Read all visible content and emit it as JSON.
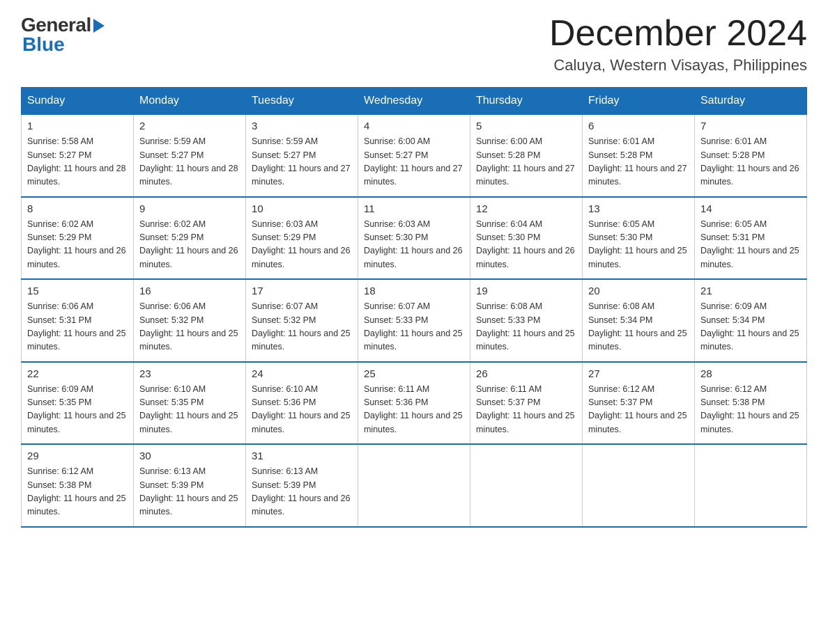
{
  "logo": {
    "general": "General",
    "blue": "Blue"
  },
  "header": {
    "month_title": "December 2024",
    "location": "Caluya, Western Visayas, Philippines"
  },
  "days_of_week": [
    "Sunday",
    "Monday",
    "Tuesday",
    "Wednesday",
    "Thursday",
    "Friday",
    "Saturday"
  ],
  "weeks": [
    [
      {
        "day": "1",
        "sunrise": "5:58 AM",
        "sunset": "5:27 PM",
        "daylight": "11 hours and 28 minutes."
      },
      {
        "day": "2",
        "sunrise": "5:59 AM",
        "sunset": "5:27 PM",
        "daylight": "11 hours and 28 minutes."
      },
      {
        "day": "3",
        "sunrise": "5:59 AM",
        "sunset": "5:27 PM",
        "daylight": "11 hours and 27 minutes."
      },
      {
        "day": "4",
        "sunrise": "6:00 AM",
        "sunset": "5:27 PM",
        "daylight": "11 hours and 27 minutes."
      },
      {
        "day": "5",
        "sunrise": "6:00 AM",
        "sunset": "5:28 PM",
        "daylight": "11 hours and 27 minutes."
      },
      {
        "day": "6",
        "sunrise": "6:01 AM",
        "sunset": "5:28 PM",
        "daylight": "11 hours and 27 minutes."
      },
      {
        "day": "7",
        "sunrise": "6:01 AM",
        "sunset": "5:28 PM",
        "daylight": "11 hours and 26 minutes."
      }
    ],
    [
      {
        "day": "8",
        "sunrise": "6:02 AM",
        "sunset": "5:29 PM",
        "daylight": "11 hours and 26 minutes."
      },
      {
        "day": "9",
        "sunrise": "6:02 AM",
        "sunset": "5:29 PM",
        "daylight": "11 hours and 26 minutes."
      },
      {
        "day": "10",
        "sunrise": "6:03 AM",
        "sunset": "5:29 PM",
        "daylight": "11 hours and 26 minutes."
      },
      {
        "day": "11",
        "sunrise": "6:03 AM",
        "sunset": "5:30 PM",
        "daylight": "11 hours and 26 minutes."
      },
      {
        "day": "12",
        "sunrise": "6:04 AM",
        "sunset": "5:30 PM",
        "daylight": "11 hours and 26 minutes."
      },
      {
        "day": "13",
        "sunrise": "6:05 AM",
        "sunset": "5:30 PM",
        "daylight": "11 hours and 25 minutes."
      },
      {
        "day": "14",
        "sunrise": "6:05 AM",
        "sunset": "5:31 PM",
        "daylight": "11 hours and 25 minutes."
      }
    ],
    [
      {
        "day": "15",
        "sunrise": "6:06 AM",
        "sunset": "5:31 PM",
        "daylight": "11 hours and 25 minutes."
      },
      {
        "day": "16",
        "sunrise": "6:06 AM",
        "sunset": "5:32 PM",
        "daylight": "11 hours and 25 minutes."
      },
      {
        "day": "17",
        "sunrise": "6:07 AM",
        "sunset": "5:32 PM",
        "daylight": "11 hours and 25 minutes."
      },
      {
        "day": "18",
        "sunrise": "6:07 AM",
        "sunset": "5:33 PM",
        "daylight": "11 hours and 25 minutes."
      },
      {
        "day": "19",
        "sunrise": "6:08 AM",
        "sunset": "5:33 PM",
        "daylight": "11 hours and 25 minutes."
      },
      {
        "day": "20",
        "sunrise": "6:08 AM",
        "sunset": "5:34 PM",
        "daylight": "11 hours and 25 minutes."
      },
      {
        "day": "21",
        "sunrise": "6:09 AM",
        "sunset": "5:34 PM",
        "daylight": "11 hours and 25 minutes."
      }
    ],
    [
      {
        "day": "22",
        "sunrise": "6:09 AM",
        "sunset": "5:35 PM",
        "daylight": "11 hours and 25 minutes."
      },
      {
        "day": "23",
        "sunrise": "6:10 AM",
        "sunset": "5:35 PM",
        "daylight": "11 hours and 25 minutes."
      },
      {
        "day": "24",
        "sunrise": "6:10 AM",
        "sunset": "5:36 PM",
        "daylight": "11 hours and 25 minutes."
      },
      {
        "day": "25",
        "sunrise": "6:11 AM",
        "sunset": "5:36 PM",
        "daylight": "11 hours and 25 minutes."
      },
      {
        "day": "26",
        "sunrise": "6:11 AM",
        "sunset": "5:37 PM",
        "daylight": "11 hours and 25 minutes."
      },
      {
        "day": "27",
        "sunrise": "6:12 AM",
        "sunset": "5:37 PM",
        "daylight": "11 hours and 25 minutes."
      },
      {
        "day": "28",
        "sunrise": "6:12 AM",
        "sunset": "5:38 PM",
        "daylight": "11 hours and 25 minutes."
      }
    ],
    [
      {
        "day": "29",
        "sunrise": "6:12 AM",
        "sunset": "5:38 PM",
        "daylight": "11 hours and 25 minutes."
      },
      {
        "day": "30",
        "sunrise": "6:13 AM",
        "sunset": "5:39 PM",
        "daylight": "11 hours and 25 minutes."
      },
      {
        "day": "31",
        "sunrise": "6:13 AM",
        "sunset": "5:39 PM",
        "daylight": "11 hours and 26 minutes."
      },
      null,
      null,
      null,
      null
    ]
  ]
}
